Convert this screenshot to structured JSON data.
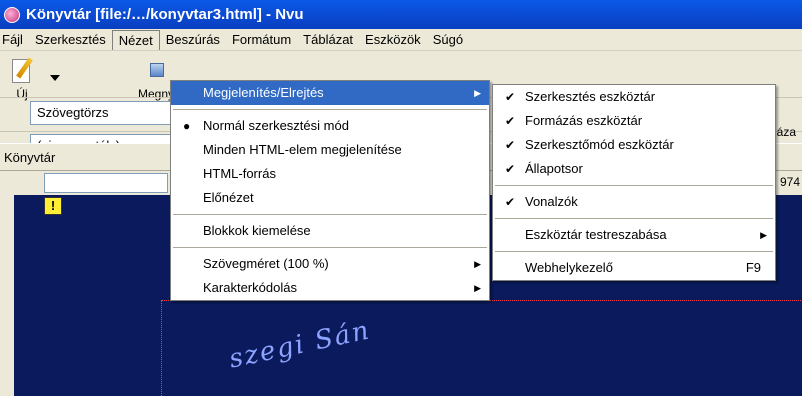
{
  "window": {
    "title": "Könyvtár [file:/…/konyvtar3.html] - Nvu"
  },
  "menubar": {
    "items": [
      {
        "label": "Fájl",
        "active": false
      },
      {
        "label": "Szerkesztés",
        "active": false
      },
      {
        "label": "Nézet",
        "active": true
      },
      {
        "label": "Beszúrás",
        "active": false
      },
      {
        "label": "Formátum",
        "active": false
      },
      {
        "label": "Táblázat",
        "active": false
      },
      {
        "label": "Eszközök",
        "active": false
      },
      {
        "label": "Súgó",
        "active": false
      }
    ]
  },
  "toolbar": {
    "new_label": "Új",
    "open_label": "Megny",
    "right_label": "láza",
    "paragraph_combo": "Szövegtörzs",
    "class_combo": "(nincs osztály)",
    "right_number": "974"
  },
  "sidebar": {
    "tab_label": "Könyvtár"
  },
  "canvas": {
    "warning_glyph": "!",
    "curved_text": "szegi Sán"
  },
  "view_menu": {
    "items": [
      {
        "label": "Megjelenítés/Elrejtés",
        "submenu": true,
        "highlighted": true
      },
      {
        "type": "separator"
      },
      {
        "label": "Normál szerkesztési mód",
        "mark": "●"
      },
      {
        "label": "Minden HTML-elem megjelenítése"
      },
      {
        "label": "HTML-forrás"
      },
      {
        "label": "Előnézet"
      },
      {
        "type": "separator"
      },
      {
        "label": "Blokkok kiemelése"
      },
      {
        "type": "separator"
      },
      {
        "label": "Szövegméret (100 %)",
        "submenu": true
      },
      {
        "label": "Karakterkódolás",
        "submenu": true
      }
    ]
  },
  "show_hide_submenu": {
    "items": [
      {
        "label": "Szerkesztés eszköztár",
        "mark": "✔"
      },
      {
        "label": "Formázás eszköztár",
        "mark": "✔"
      },
      {
        "label": "Szerkesztőmód eszköztár",
        "mark": "✔"
      },
      {
        "label": "Állapotsor",
        "mark": "✔"
      },
      {
        "type": "separator"
      },
      {
        "label": "Vonalzók",
        "mark": "✔"
      },
      {
        "type": "separator"
      },
      {
        "label": "Eszköztár testreszabása",
        "submenu": true
      },
      {
        "type": "separator"
      },
      {
        "label": "Webhelykezelő",
        "shortcut": "F9"
      }
    ]
  },
  "icons": {
    "submenu_arrow": "▶",
    "combo_arrow": "▼"
  },
  "colors": {
    "titlebar": "#0b4cd6",
    "menu_highlight": "#316ac5",
    "canvas_bg": "#0a1a5c"
  }
}
